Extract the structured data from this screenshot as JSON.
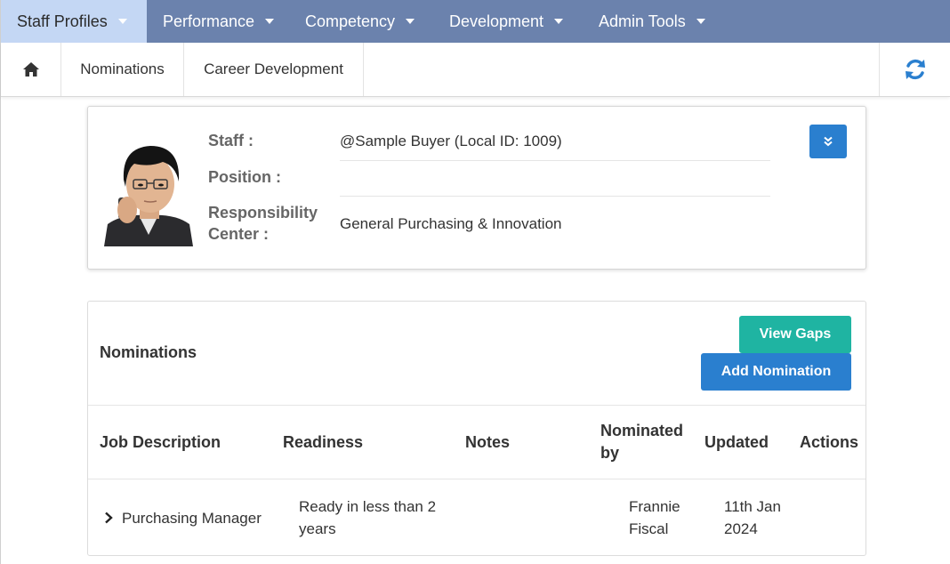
{
  "topnav": {
    "items": [
      {
        "label": "Staff Profiles"
      },
      {
        "label": "Performance"
      },
      {
        "label": "Competency"
      },
      {
        "label": "Development"
      },
      {
        "label": "Admin Tools"
      }
    ]
  },
  "subnav": {
    "home_icon": "home-icon",
    "items": [
      {
        "label": "Nominations"
      },
      {
        "label": "Career Development"
      }
    ],
    "refresh_icon": "refresh-icon"
  },
  "profile": {
    "staff_label": "Staff :",
    "staff_value": "@Sample Buyer (Local ID: 1009)",
    "position_label": "Position :",
    "position_value": "",
    "rc_label_line1": "Responsibility",
    "rc_label_line2": "Center :",
    "rc_value": "General Purchasing & Innovation",
    "expand_icon": "double-chevron-down-icon"
  },
  "nominations": {
    "title": "Nominations",
    "view_gaps_label": "View Gaps",
    "add_nomination_label": "Add Nomination",
    "columns": {
      "job": "Job Description",
      "readiness": "Readiness",
      "notes": "Notes",
      "nominated_line1": "Nominated",
      "nominated_line2": "by",
      "updated": "Updated",
      "actions": "Actions"
    },
    "rows": [
      {
        "job": "Purchasing Manager",
        "readiness_line1": "Ready in less than 2",
        "readiness_line2": "years",
        "notes": "",
        "nominated_line1": "Frannie",
        "nominated_line2": "Fiscal",
        "updated_line1": "11th Jan",
        "updated_line2": "2024"
      }
    ]
  },
  "colors": {
    "nav_bg": "#6b82ad",
    "nav_active_bg": "#c4d7f4",
    "primary": "#2a7fcf",
    "teal": "#1fb4a2"
  }
}
